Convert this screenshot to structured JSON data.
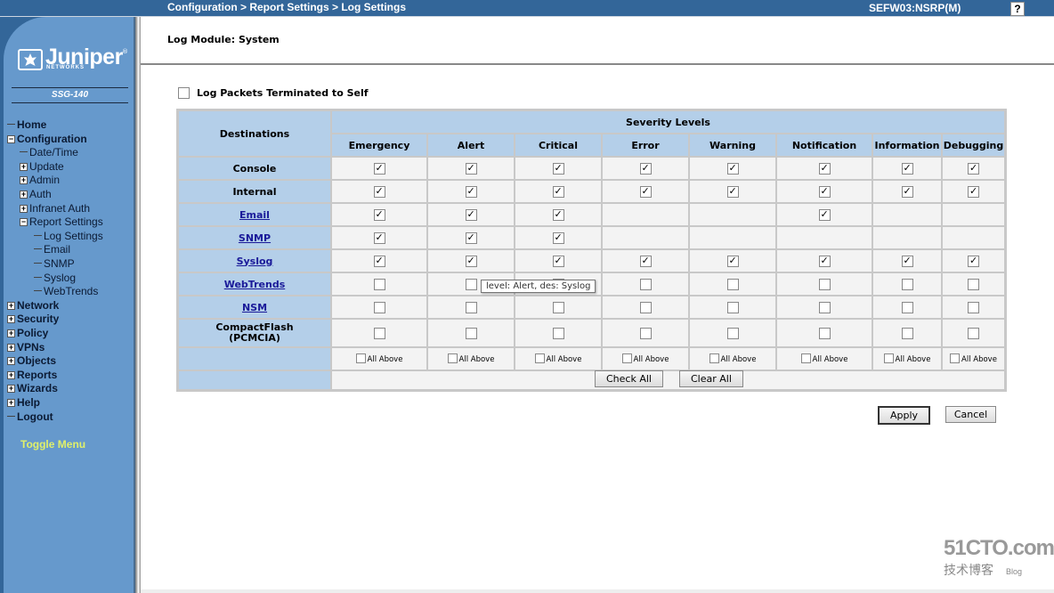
{
  "header": {
    "breadcrumb": "Configuration > Report Settings > Log Settings",
    "device": "SEFW03:NSRP(M)",
    "help_label": "?"
  },
  "sidebar": {
    "logo_word": "Juniper",
    "logo_sub": "NETWORKS",
    "logo_reg": "®",
    "model": "SSG-140",
    "items": [
      {
        "label": "Home",
        "level": 0,
        "toggle": "none"
      },
      {
        "label": "Configuration",
        "level": 0,
        "toggle": "minus"
      },
      {
        "label": "Date/Time",
        "level": 1,
        "toggle": "none"
      },
      {
        "label": "Update",
        "level": 1,
        "toggle": "plus"
      },
      {
        "label": "Admin",
        "level": 1,
        "toggle": "plus"
      },
      {
        "label": "Auth",
        "level": 1,
        "toggle": "plus"
      },
      {
        "label": "Infranet Auth",
        "level": 1,
        "toggle": "plus"
      },
      {
        "label": "Report Settings",
        "level": 1,
        "toggle": "minus"
      },
      {
        "label": "Log Settings",
        "level": 2,
        "toggle": "none"
      },
      {
        "label": "Email",
        "level": 2,
        "toggle": "none"
      },
      {
        "label": "SNMP",
        "level": 2,
        "toggle": "none"
      },
      {
        "label": "Syslog",
        "level": 2,
        "toggle": "none"
      },
      {
        "label": "WebTrends",
        "level": 2,
        "toggle": "none"
      },
      {
        "label": "Network",
        "level": 0,
        "toggle": "plus"
      },
      {
        "label": "Security",
        "level": 0,
        "toggle": "plus"
      },
      {
        "label": "Policy",
        "level": 0,
        "toggle": "plus"
      },
      {
        "label": "VPNs",
        "level": 0,
        "toggle": "plus"
      },
      {
        "label": "Objects",
        "level": 0,
        "toggle": "plus"
      },
      {
        "label": "Reports",
        "level": 0,
        "toggle": "plus"
      },
      {
        "label": "Wizards",
        "level": 0,
        "toggle": "plus"
      },
      {
        "label": "Help",
        "level": 0,
        "toggle": "plus"
      },
      {
        "label": "Logout",
        "level": 0,
        "toggle": "none"
      }
    ],
    "toggle_menu": "Toggle Menu"
  },
  "main": {
    "module_title": "Log Module: System",
    "log_self_label": "Log Packets Terminated to Self",
    "log_self_checked": false,
    "table": {
      "dest_header": "Destinations",
      "severity_header": "Severity Levels",
      "levels": [
        "Emergency",
        "Alert",
        "Critical",
        "Error",
        "Warning",
        "Notification",
        "Information",
        "Debugging"
      ],
      "rows": [
        {
          "dest": "Console",
          "link": false,
          "cells": [
            true,
            true,
            true,
            true,
            true,
            true,
            true,
            true
          ]
        },
        {
          "dest": "Internal",
          "link": false,
          "cells": [
            true,
            true,
            true,
            true,
            true,
            true,
            true,
            true
          ]
        },
        {
          "dest": "Email",
          "link": true,
          "cells": [
            true,
            true,
            true,
            null,
            null,
            true,
            null,
            null
          ]
        },
        {
          "dest": "SNMP",
          "link": true,
          "cells": [
            true,
            true,
            true,
            null,
            null,
            null,
            null,
            null
          ]
        },
        {
          "dest": "Syslog",
          "link": true,
          "cells": [
            true,
            true,
            true,
            true,
            true,
            true,
            true,
            true
          ]
        },
        {
          "dest": "WebTrends",
          "link": true,
          "cells": [
            false,
            false,
            false,
            false,
            false,
            false,
            false,
            false
          ]
        },
        {
          "dest": "NSM",
          "link": true,
          "cells": [
            false,
            false,
            false,
            false,
            false,
            false,
            false,
            false
          ]
        },
        {
          "dest": "CompactFlash\n(PCMCIA)",
          "dest_line1": "CompactFlash",
          "dest_line2": "(PCMCIA)",
          "link": false,
          "cells": [
            false,
            false,
            false,
            false,
            false,
            false,
            false,
            false
          ]
        }
      ],
      "all_above_label": "All Above",
      "all_above_checked": [
        false,
        false,
        false,
        false,
        false,
        false,
        false,
        false
      ]
    },
    "check_all_label": "Check All",
    "clear_all_label": "Clear All",
    "apply_label": "Apply",
    "cancel_label": "Cancel",
    "tooltip": "level: Alert, des: Syslog"
  },
  "watermark": {
    "big": "51CTO.com",
    "small": "技术博客",
    "blog": "Blog"
  }
}
